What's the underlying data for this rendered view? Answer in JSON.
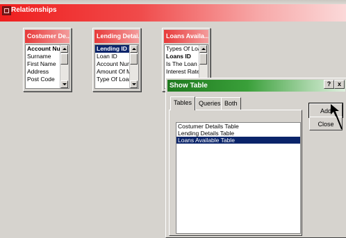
{
  "window": {
    "title": "Relationships"
  },
  "tables": [
    {
      "title": "Costumer De...",
      "fields": [
        "Account Numl",
        "Surname",
        "First Name",
        "Address",
        "Post Code"
      ],
      "key_index": 0,
      "selected_index": -1
    },
    {
      "title": "Lending Detai...",
      "fields": [
        "Lending ID Nu",
        "Loan ID",
        "Account Numb",
        "Amount Of Mc",
        "Type Of Loan"
      ],
      "key_index": 0,
      "selected_index": 0
    },
    {
      "title": "Loans Availa...",
      "fields": [
        "Types Of Loar",
        "Loans ID",
        "Is The Loan A",
        "Interest Rate"
      ],
      "key_index": 1,
      "selected_index": -1
    }
  ],
  "dialog": {
    "title": "Show Table",
    "help_label": "?",
    "close_label": "x",
    "tabs": [
      "Tables",
      "Queries",
      "Both"
    ],
    "active_tab": "Tables",
    "items": [
      "Costumer Details Table",
      "Lending Details Table",
      "Loans Available Table"
    ],
    "selected_item": "Loans Available Table",
    "add_label": "Add",
    "close_button_label": "Close"
  },
  "icons": {
    "window": "relationships-icon",
    "cursor": "mouse-pointer-icon"
  },
  "colors": {
    "title_bar": "#ef1f1f",
    "dialog_title": "#1f7a1f",
    "selection": "#0a246a",
    "workspace": "#d6d3ce"
  }
}
